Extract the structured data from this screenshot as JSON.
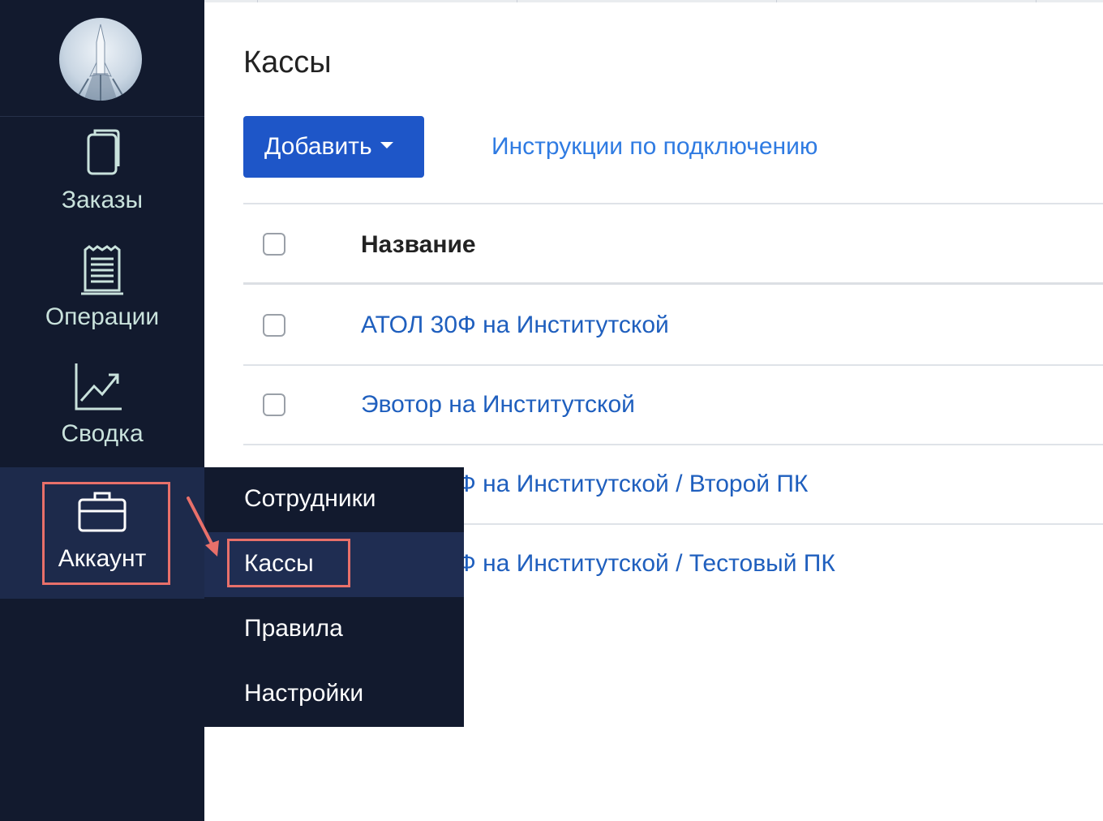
{
  "sidebar": {
    "nav": [
      {
        "id": "orders",
        "label": "Заказы",
        "icon": "copy-icon"
      },
      {
        "id": "operations",
        "label": "Операции",
        "icon": "receipt-icon"
      },
      {
        "id": "summary",
        "label": "Сводка",
        "icon": "chart-line-icon"
      },
      {
        "id": "account",
        "label": "Аккаунт",
        "icon": "briefcase-icon",
        "active": true
      }
    ],
    "submenu": [
      {
        "label": "Сотрудники"
      },
      {
        "label": "Кассы",
        "active": true
      },
      {
        "label": "Правила"
      },
      {
        "label": "Настройки"
      }
    ]
  },
  "main": {
    "title": "Кассы",
    "add_button": "Добавить",
    "instructions_link": "Инструкции по подключению",
    "table": {
      "header": "Название",
      "rows": [
        {
          "name": "АТОЛ 30Ф на Институтской"
        },
        {
          "name": "Эвотор на Институтской"
        },
        {
          "name": "АТОЛ 30Ф на Институтской / Второй ПК"
        },
        {
          "name": "АТОЛ 30Ф на Институтской / Тестовый ПК"
        }
      ]
    }
  },
  "colors": {
    "sidebar_bg": "#121a2e",
    "active_bg": "#1d2a4b",
    "primary_button": "#1e56c8",
    "link": "#1f5fbe",
    "highlight": "#e8706a"
  }
}
